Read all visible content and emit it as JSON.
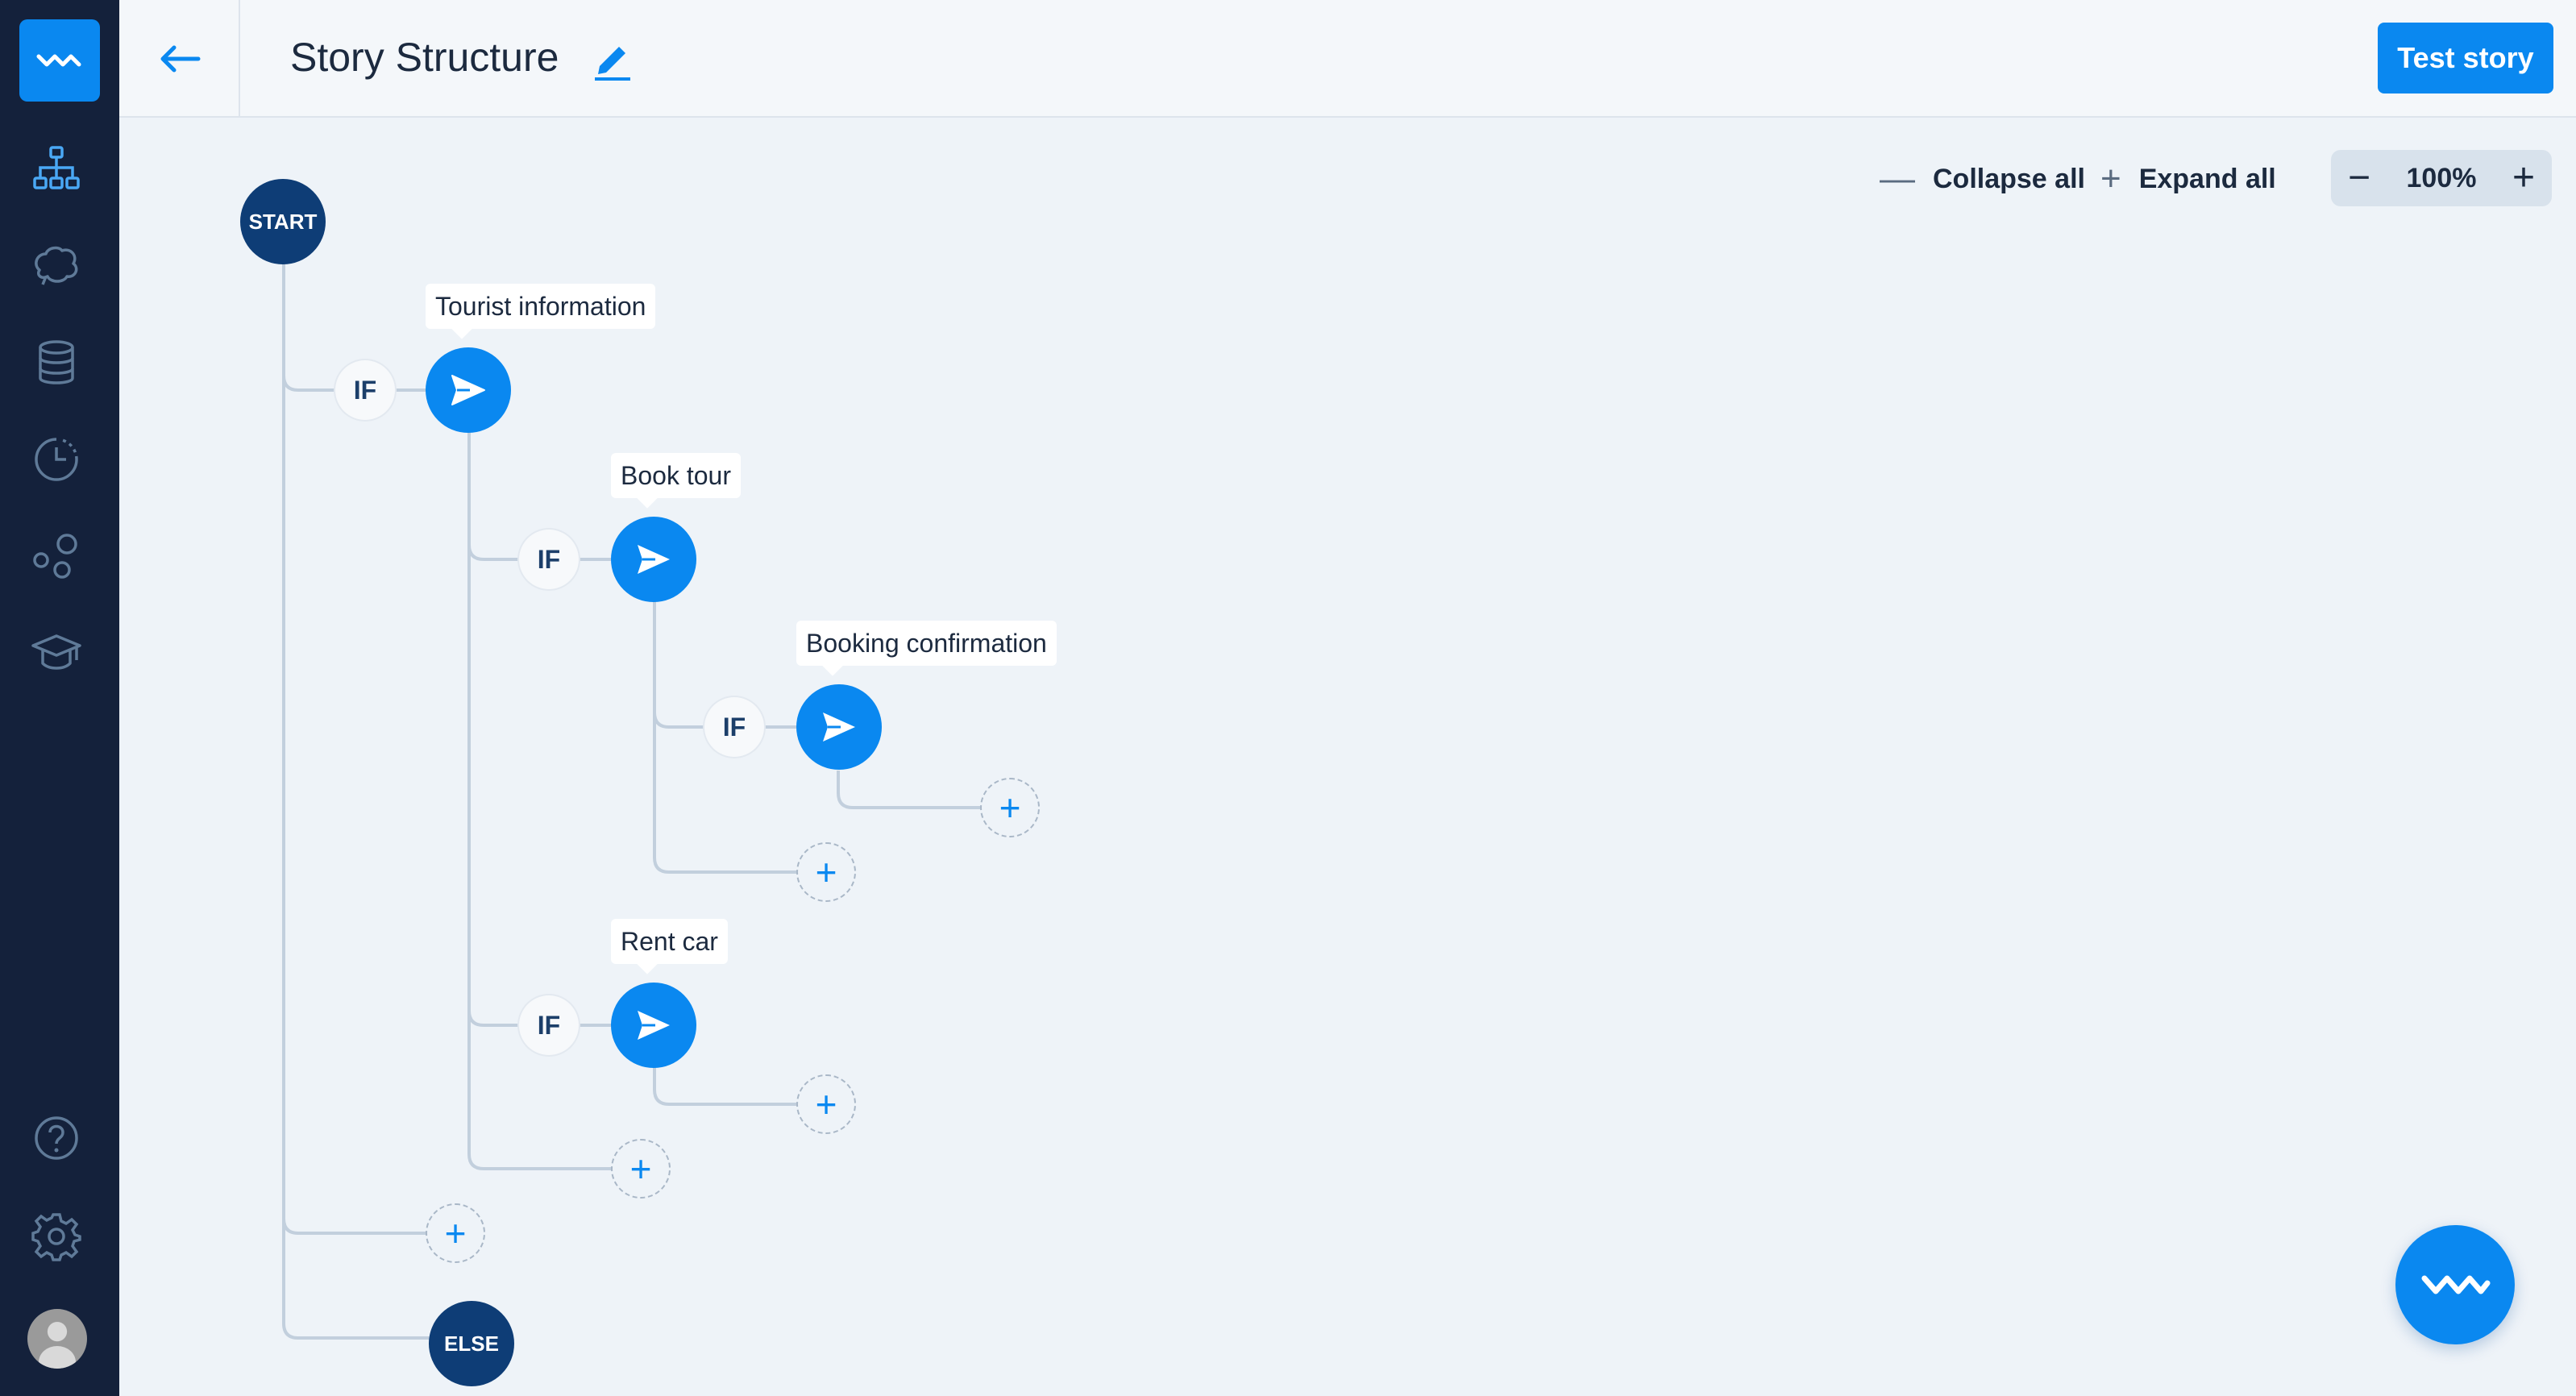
{
  "header": {
    "title": "Story Structure",
    "test_button": "Test story"
  },
  "toolbar": {
    "collapse_label": "Collapse all",
    "expand_label": "Expand all",
    "zoom_level": "100%"
  },
  "tree": {
    "start_label": "START",
    "else_label": "ELSE",
    "if_label": "IF",
    "interactions": [
      "Tourist information",
      "Book tour",
      "Booking confirmation",
      "Rent car"
    ]
  },
  "sidebar": {
    "items": [
      "structure-icon",
      "brain-icon",
      "database-icon",
      "analytics-icon",
      "integrations-icon",
      "training-icon",
      "help-icon",
      "settings-icon",
      "avatar"
    ]
  },
  "colors": {
    "primary": "#0a88f0",
    "dark_node": "#0e3d76",
    "sidebar": "#14213b"
  }
}
